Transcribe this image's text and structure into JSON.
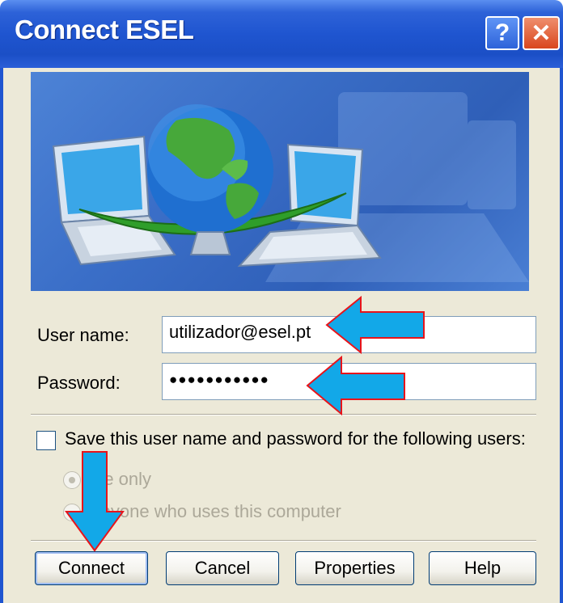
{
  "window": {
    "title": "Connect ESEL",
    "help_glyph": "?",
    "close_glyph": "✕"
  },
  "form": {
    "username_label": "User name:",
    "username_value": "utilizador@esel.pt",
    "password_label": "Password:",
    "password_value": "●●●●●●●●●●●"
  },
  "save": {
    "label": "Save this user name and password for the following users:",
    "checked": false,
    "options": [
      {
        "label": "Me only",
        "selected": true,
        "enabled": false
      },
      {
        "label": "Anyone who uses this computer",
        "selected": false,
        "enabled": false
      }
    ]
  },
  "buttons": {
    "connect": "Connect",
    "cancel": "Cancel",
    "properties": "Properties",
    "help": "Help"
  },
  "colors": {
    "title_bar": "#1f55d0",
    "dialog_bg": "#ece9d8",
    "arrow_fill": "#12a8e8",
    "arrow_outline": "#e8141a"
  },
  "icons": [
    "network-globe-laptops-icon",
    "help-icon",
    "close-icon",
    "annotation-arrow-icon"
  ]
}
